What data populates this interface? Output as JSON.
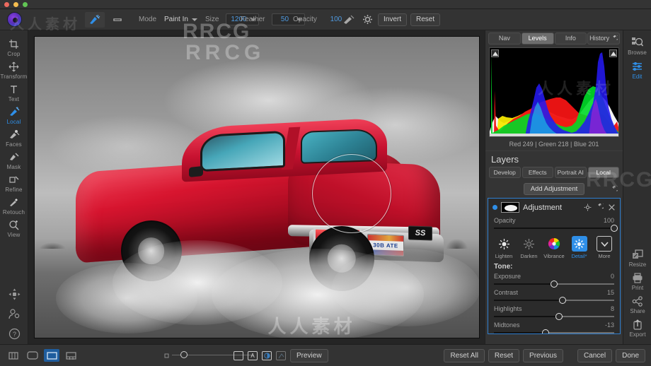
{
  "window": {
    "traffic_lights": [
      "close",
      "minimize",
      "maximize"
    ],
    "app_logo": "on1-logo-icon"
  },
  "toolbar": {
    "tools": [
      {
        "name": "local-brush-tool",
        "icon": "brush-icon",
        "active": true
      },
      {
        "name": "mask-bug-tool",
        "icon": "adjustable-gradient-icon",
        "active": false
      }
    ],
    "mode_label": "Mode",
    "mode_value": "Paint In",
    "size_label": "Size",
    "size_value": "1200",
    "feather_label": "Feather",
    "feather_value": "50",
    "opacity_label": "Opacity",
    "opacity_value": "100",
    "brush_preset_icon": "brush-stroke-icon",
    "settings_icon": "gear-icon",
    "invert_label": "Invert",
    "reset_label": "Reset"
  },
  "left_rail": {
    "items": [
      {
        "label": "Crop",
        "icon": "crop-icon",
        "active": false
      },
      {
        "label": "Transform",
        "icon": "move-icon",
        "active": false
      },
      {
        "label": "Text",
        "icon": "text-icon",
        "active": false
      },
      {
        "label": "Local",
        "icon": "local-brush-icon",
        "active": true
      },
      {
        "label": "Faces",
        "icon": "faces-icon",
        "active": false
      },
      {
        "label": "Mask",
        "icon": "mask-icon",
        "active": false
      },
      {
        "label": "Refine",
        "icon": "refine-icon",
        "active": false
      },
      {
        "label": "Retouch",
        "icon": "retouch-icon",
        "active": false
      },
      {
        "label": "View",
        "icon": "view-magnifier-icon",
        "active": false
      }
    ],
    "bottom_icons": [
      "pan-navigator-icon",
      "user-settings-icon",
      "help-icon"
    ]
  },
  "right_rail": {
    "top_items": [
      {
        "label": "Browse",
        "icon": "browse-icon",
        "active": false
      },
      {
        "label": "Edit",
        "icon": "edit-icon",
        "active": true
      }
    ],
    "bottom_items": [
      {
        "label": "Resize",
        "icon": "resize-icon"
      },
      {
        "label": "Print",
        "icon": "printer-icon"
      },
      {
        "label": "Share",
        "icon": "share-icon"
      },
      {
        "label": "Export",
        "icon": "export-icon"
      }
    ]
  },
  "panel": {
    "tabs": [
      {
        "label": "Nav",
        "active": false
      },
      {
        "label": "Levels",
        "active": true
      },
      {
        "label": "Info",
        "active": false
      },
      {
        "label": "History",
        "active": false,
        "icon": "undo-icon"
      }
    ],
    "rgb_readout": "Red 249 | Green 218 | Blue 201",
    "layers_title": "Layers",
    "layer_tabs": [
      {
        "label": "Develop",
        "active": false
      },
      {
        "label": "Effects",
        "active": false
      },
      {
        "label": "Portrait AI",
        "active": false
      },
      {
        "label": "Local",
        "active": true
      }
    ],
    "add_adjustment_label": "Add Adjustment",
    "reset_history_icon": "undo-icon",
    "adjustment": {
      "name": "Adjustment",
      "enabled_dot_color": "#2f8fe8",
      "mask_thumbnail": "mask-thumbnail-icon",
      "header_icons": [
        "gear-icon",
        "undo-icon",
        "close-icon"
      ],
      "opacity_label": "Opacity",
      "opacity_value": "100",
      "opacity_pct": 100,
      "tools": [
        {
          "label": "Lighten",
          "icon": "sun-light-icon",
          "active": false,
          "boxed": false
        },
        {
          "label": "Darken",
          "icon": "sun-dark-icon",
          "active": false,
          "boxed": false
        },
        {
          "label": "Vibrance",
          "icon": "color-wheel-icon",
          "active": false,
          "boxed": false
        },
        {
          "label": "Detail*",
          "icon": "detail-star-icon",
          "active": true,
          "boxed": false
        },
        {
          "label": "More",
          "icon": "chevron-down-icon",
          "active": false,
          "boxed": true
        }
      ],
      "tone_label": "Tone:",
      "sliders": [
        {
          "label": "Exposure",
          "value": "0",
          "pct": 50
        },
        {
          "label": "Contrast",
          "value": "15",
          "pct": 57
        },
        {
          "label": "Highlights",
          "value": "8",
          "pct": 54
        },
        {
          "label": "Midtones",
          "value": "-13",
          "pct": 43
        }
      ]
    }
  },
  "bottom_bar": {
    "view_icons": [
      {
        "name": "single-view-icon",
        "active": false
      },
      {
        "name": "compare-view-icon",
        "active": false
      },
      {
        "name": "split-view-icon",
        "active": true
      },
      {
        "name": "grid-view-icon",
        "active": false
      }
    ],
    "zoom_percent": 12,
    "center_icons": [
      {
        "name": "mask-square-icon",
        "label": ""
      },
      {
        "name": "mask-letter-a-icon",
        "label": "A"
      },
      {
        "name": "mask-circle-icon",
        "label": ""
      },
      {
        "name": "mask-dim-icon",
        "label": ""
      }
    ],
    "preview_label": "Preview",
    "buttons": [
      {
        "label": "Reset All",
        "name": "reset-all-button"
      },
      {
        "label": "Reset",
        "name": "reset-button"
      },
      {
        "label": "Previous",
        "name": "previous-button"
      },
      {
        "label": "Cancel",
        "name": "cancel-button"
      },
      {
        "label": "Done",
        "name": "done-button"
      }
    ]
  },
  "photo": {
    "subject": "red muscle car burnout",
    "license_plate_text": "30B ATE",
    "badge_text": "SS",
    "brush_cursor_visible": true
  },
  "watermarks": {
    "rrcg": "RRCG",
    "cn_small": "人人素材",
    "cn_large": "人人素材"
  },
  "colors": {
    "accent": "#2f8fe8",
    "panel_bg": "#343434",
    "app_bg": "#2e2e2e",
    "car_red": "#c71230"
  }
}
